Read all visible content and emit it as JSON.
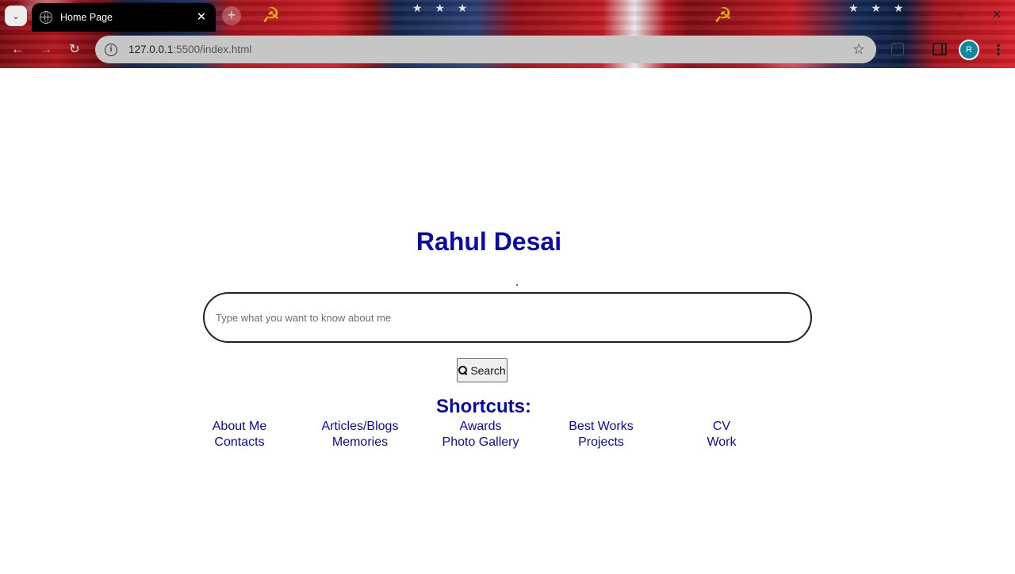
{
  "browser": {
    "tab_title": "Home Page",
    "tab_close": "✕",
    "new_tab": "+",
    "url_host": "127.0.0.1",
    "url_path": ":5500/index.html",
    "avatar_initial": "R",
    "theme_colors": {
      "red": "#b0141c",
      "navy": "#1c2e5a",
      "gold": "#f2c21a"
    }
  },
  "page": {
    "title": "Rahul Desai",
    "search": {
      "placeholder": "Type what you want to know about me",
      "value": "",
      "button_label": "Search"
    },
    "shortcuts_heading": "Shortcuts:",
    "shortcuts": [
      "About Me",
      "Articles/Blogs",
      "Awards",
      "Best Works",
      "CV",
      "Contacts",
      "Memories",
      "Photo Gallery",
      "Projects",
      "Work"
    ],
    "colors": {
      "heading": "#0a0aa8",
      "link": "#0a0aa8"
    }
  }
}
